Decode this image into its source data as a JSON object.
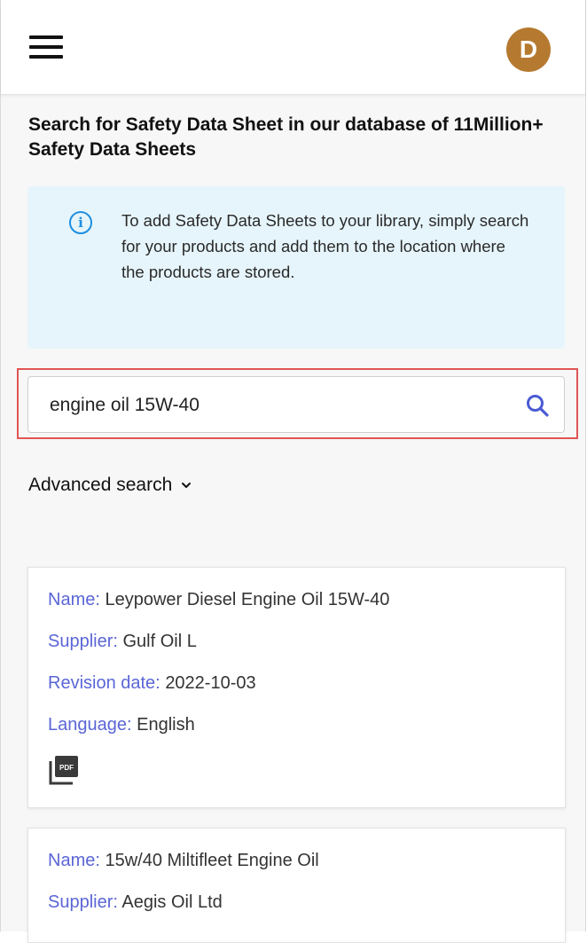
{
  "header": {
    "avatar_letter": "D",
    "menu_icon": "hamburger-menu-icon"
  },
  "page": {
    "title": "Search for Safety Data Sheet in our database of 11Million+ Safety Data Sheets"
  },
  "info": {
    "icon": "info-icon",
    "icon_glyph": "i",
    "text": "To add Safety Data Sheets to your library, simply search for your products and add them to the location where the products are stored."
  },
  "search": {
    "value": "engine oil 15W-40",
    "icon": "search-icon"
  },
  "advanced": {
    "label": "Advanced search",
    "icon": "chevron-down-icon"
  },
  "colors": {
    "avatar": "#b57a30",
    "label": "#5a66d6",
    "info_bg": "#e6f5fb",
    "info_icon": "#1f8fe0",
    "highlight": "#e05555"
  },
  "results": [
    {
      "name_label": "Name:",
      "name": "Leypower Diesel Engine Oil 15W-40",
      "supplier_label": "Supplier:",
      "supplier": "Gulf Oil L",
      "revision_label": "Revision date:",
      "revision": "2022-10-03",
      "language_label": "Language:",
      "language": "English",
      "pdf_label": "PDF",
      "pdf_icon": "pdf-icon"
    },
    {
      "name_label": "Name:",
      "name": "15w/40 Miltifleet Engine Oil",
      "supplier_label": "Supplier:",
      "supplier": "Aegis Oil Ltd"
    }
  ]
}
